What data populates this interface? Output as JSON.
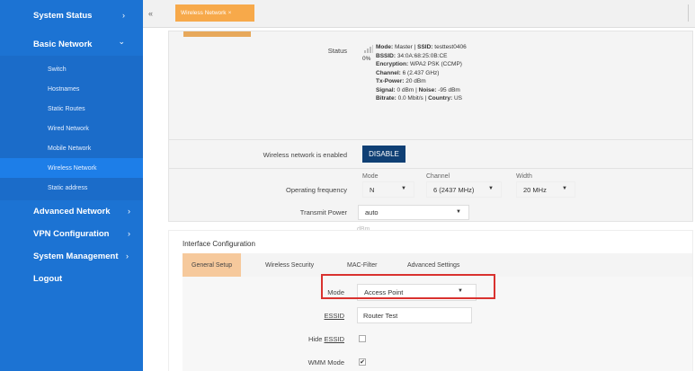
{
  "sidebar": {
    "system_status": "System Status",
    "basic_network": "Basic Network",
    "sub_items": [
      {
        "label": "Switch"
      },
      {
        "label": "Hostnames"
      },
      {
        "label": "Static Routes"
      },
      {
        "label": "Wired Network"
      },
      {
        "label": "Mobile Network"
      },
      {
        "label": "Wireless Network"
      },
      {
        "label": "Static address"
      }
    ],
    "advanced_network": "Advanced Network",
    "vpn_configuration": "VPN Configuration",
    "system_management": "System Management",
    "logout": "Logout",
    "chevron_right": "›",
    "chevron_down": "⌄"
  },
  "tabstrip": {
    "collapse": "«",
    "active_tab": "Wireless Network",
    "close": "×"
  },
  "status": {
    "label": "Status",
    "percent": "0%",
    "line1_mode": "Mode:",
    "line1_mode_val": "Master |",
    "line1_ssid": "SSID:",
    "line1_ssid_val": "testtest0406",
    "bssid_key": "BSSID:",
    "bssid_val": "34:0A:68:25:0B:CE",
    "enc_key": "Encryption:",
    "enc_val": "WPA2 PSK (CCMP)",
    "channel_key": "Channel:",
    "channel_val": "6 (2.437 GHz)",
    "tx_key": "Tx-Power:",
    "tx_val": "20 dBm",
    "signal_key": "Signal:",
    "signal_val": "0 dBm |",
    "noise_key": "Noise:",
    "noise_val": "-95 dBm",
    "bitrate_key": "Bitrate:",
    "bitrate_val": "0.0 Mbit/s |",
    "country_key": "Country:",
    "country_val": "US"
  },
  "enabled_row": {
    "label": "Wireless network is enabled",
    "button": "DISABLE"
  },
  "freq_row": {
    "label": "Operating frequency",
    "mode_label": "Mode",
    "mode_value": "N",
    "channel_label": "Channel",
    "channel_value": "6 (2437 MHz)",
    "width_label": "Width",
    "width_value": "20 MHz"
  },
  "tx_row": {
    "label": "Transmit Power",
    "value": "auto",
    "unit": "dBm"
  },
  "interface": {
    "title": "Interface Configuration",
    "tabs": [
      "General Setup",
      "Wireless Security",
      "MAC-Filter",
      "Advanced Settings"
    ],
    "mode_label": "Mode",
    "mode_value": "Access Point",
    "essid_label": "ESSID",
    "essid_value": "Router Test",
    "hide_label": "Hide",
    "hide_essid": "ESSID",
    "wmm_label": "WMM Mode",
    "wmm_check": "✔"
  },
  "colors": {
    "sidebar": "#1c73d3",
    "tab_active": "#f7a94a",
    "button": "#0f3f74",
    "highlight": "#d9322f"
  }
}
